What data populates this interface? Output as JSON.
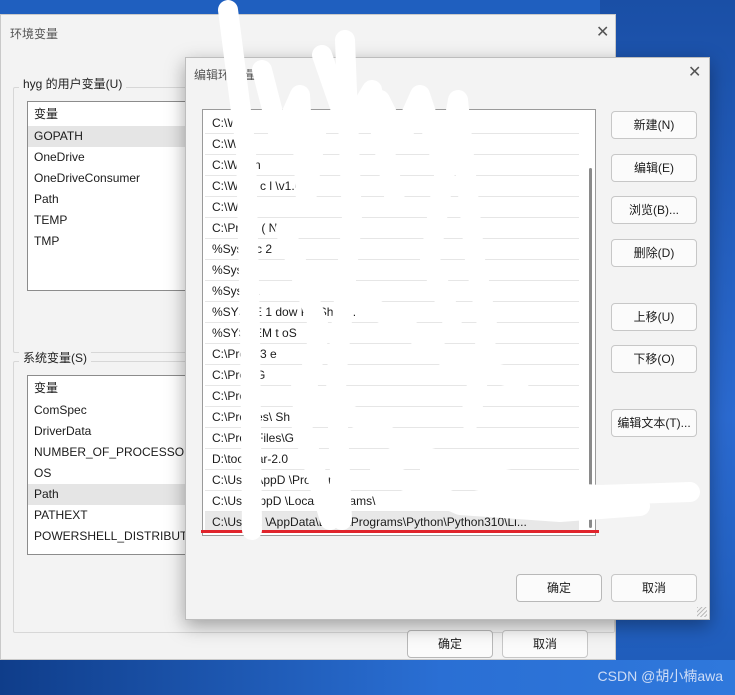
{
  "back_window": {
    "title": "环境变量",
    "user_vars_label": "hyg 的用户变量(U)",
    "user_vars_header": "变量",
    "user_vars": [
      "GOPATH",
      "OneDrive",
      "OneDriveConsumer",
      "Path",
      "TEMP",
      "TMP"
    ],
    "system_vars_label": "系统变量(S)",
    "system_vars_header": "变量",
    "system_vars": [
      "ComSpec",
      "DriverData",
      "NUMBER_OF_PROCESSOR",
      "OS",
      "Path",
      "PATHEXT",
      "POWERSHELL_DISTRIBUTI"
    ],
    "ok_label": "确定",
    "cancel_label": "取消",
    "close_glyph": "✕"
  },
  "edit_dialog": {
    "title": "编辑环   变量",
    "close_glyph": "✕",
    "paths": [
      "C:\\W",
      "C:\\W",
      "C:\\Wi          s              n",
      "C:\\Wir         S                c              l        \\v1.0",
      "C:\\Wi         e",
      "C:\\Pro         N        (              N   DI",
      "%Syste        c        2",
      "%Syste",
      "%Syste              \\",
      "%SYSTE            1         dow     Po   Shel  1.",
      "%SYSTEM          t         oS",
      "C:\\Progr         3        e",
      "C:\\Prog          G",
      "C:\\Prog",
      "C:\\Prog       es\\       Sh    \\",
      "C:\\Prog    Files\\G",
      "D:\\too    2jar-2.0",
      "C:\\Use         \\AppD       \\Programs\\",
      "C:\\Use          AppD     \\Local\\Programs\\",
      "C:\\Users\\    \\AppData\\Local\\Programs\\Python\\Python310\\Li..."
    ],
    "buttons": {
      "new": "新建(N)",
      "edit": "编辑(E)",
      "browse": "浏览(B)...",
      "delete": "删除(D)",
      "move_up": "上移(U)",
      "move_down": "下移(O)",
      "edit_text": "编辑文本(T)..."
    },
    "ok_label": "确定",
    "cancel_label": "取消"
  },
  "watermark": "CSDN @胡小楠awa",
  "colors": {
    "highlight_line": "#e0242c",
    "desktop": "#1f5fbf"
  }
}
